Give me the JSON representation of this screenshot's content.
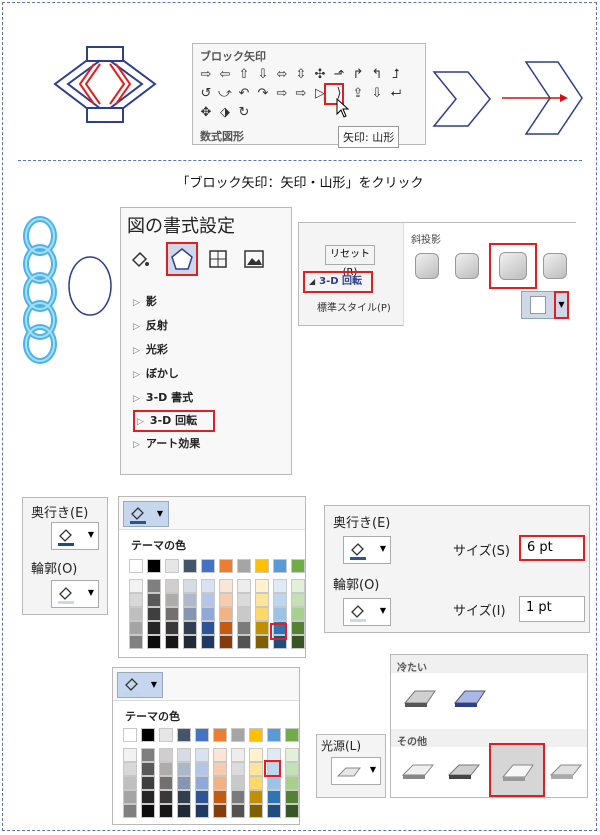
{
  "caption": "「ブロック矢印：矢印・山形」をクリック",
  "shapes_panel": {
    "title": "ブロック矢印",
    "row1": [
      "⇨",
      "⇦",
      "⇧",
      "⇩",
      "⬄",
      "⇳",
      "✣",
      "⬏",
      "↱",
      "↰",
      "⮥"
    ],
    "row2": [
      "↺",
      "⤻",
      "↶",
      "↷",
      "⇨",
      "⇨",
      "▷",
      "⟩",
      "⇪",
      "⇩",
      "⮠"
    ],
    "row3": [
      "✥",
      "⬗",
      "↻"
    ],
    "selected": "⟩",
    "tooltip": "矢印: 山形",
    "footer": "数式図形"
  },
  "format_pane": {
    "title": "図の書式設定",
    "items": [
      "影",
      "反射",
      "光彩",
      "ぼかし",
      "3-D 書式",
      "3-D 回転",
      "アート効果"
    ],
    "selected_item": "3-D 回転"
  },
  "rotation_panel": {
    "reset_label": "リセット(R)",
    "section_label": "斜投影",
    "rotation_item": "3-D 回転",
    "preset_label": "標準スタイル(P)"
  },
  "depth_panel_left": {
    "depth_label": "奥行き(E)",
    "outline_label": "輪郭(O)"
  },
  "theme_colors_1": {
    "title": "テーマの色"
  },
  "theme_colors_2": {
    "title": "テーマの色"
  },
  "depth_panel_right": {
    "depth_label": "奥行き(E)",
    "outline_label": "輪郭(O)",
    "size_label": "サイズ(S)",
    "size_value": "6 pt",
    "size2_label": "サイズ(I)",
    "size2_value": "1 pt"
  },
  "light_panel": {
    "label": "光源(L)",
    "cold_title": "冷たい",
    "other_title": "その他"
  },
  "colors": {
    "accent_red": "#e02020",
    "navy": "#2e3f8f",
    "arrow_red": "#d01010"
  },
  "theme_palette": [
    [
      "#ffffff",
      "#000000",
      "#e7e6e6",
      "#44546a",
      "#4472c4",
      "#ed7d31",
      "#a5a5a5",
      "#ffc000",
      "#5b9bd5",
      "#70ad47"
    ],
    [
      "#f2f2f2",
      "#7f7f7f",
      "#d0cece",
      "#d6dce4",
      "#d9e2f3",
      "#fbe5d5",
      "#ededed",
      "#fff2cc",
      "#deebf6",
      "#e2efd9"
    ],
    [
      "#d8d8d8",
      "#595959",
      "#aeabab",
      "#adb9ca",
      "#b4c6e7",
      "#f7cbac",
      "#dbdbdb",
      "#fee599",
      "#bdd7ee",
      "#c5e0b3"
    ],
    [
      "#bfbfbf",
      "#3f3f3f",
      "#757070",
      "#8496b0",
      "#8eaadb",
      "#f4b183",
      "#c9c9c9",
      "#ffd965",
      "#9cc3e5",
      "#a8d08d"
    ],
    [
      "#a5a5a5",
      "#262626",
      "#3a3838",
      "#323f4f",
      "#2f5496",
      "#c55a11",
      "#7b7b7b",
      "#bf9000",
      "#2e75b5",
      "#538135"
    ],
    [
      "#7f7f7f",
      "#0c0c0c",
      "#171616",
      "#222a35",
      "#1f3864",
      "#833c0b",
      "#525252",
      "#7f6000",
      "#1e4e79",
      "#375623"
    ]
  ]
}
